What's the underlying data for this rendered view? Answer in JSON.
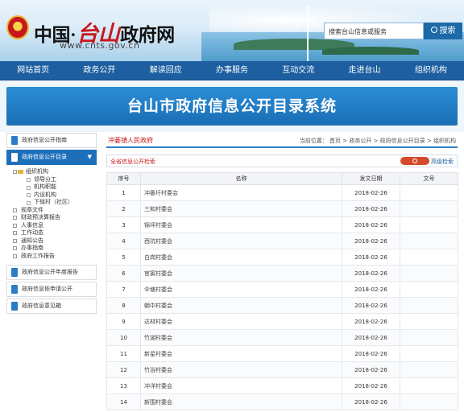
{
  "header": {
    "title_prefix": "中国·",
    "title_highlight": "台山",
    "title_suffix": "政府网",
    "url": "www.cnts.gov.cn",
    "search_placeholder": "搜索台山信息或服务",
    "search_button": "搜索"
  },
  "nav": [
    "网站首页",
    "政务公开",
    "解读回应",
    "办事服务",
    "互动交流",
    "走进台山",
    "组织机构"
  ],
  "banner_title": "台山市政府信息公开目录系统",
  "sidebar": {
    "guide": "政府信息公开指南",
    "catalog": "政府信息公开目录",
    "tree": {
      "root": "组织机构",
      "children": [
        "领导分工",
        "机构职能",
        "内设机构",
        "下辖村（社区）"
      ],
      "others": [
        "规章文件",
        "财政预决算报告",
        "人事信息",
        "工作动态",
        "通知公告",
        "办事指南",
        "政府工作报告"
      ]
    },
    "annual_report": "政府信息公开年度报告",
    "apply": "政府信息依申请公开",
    "feedback": "政府信息意见箱"
  },
  "main": {
    "org_name": "冲蒌镇人民政府",
    "breadcrumb": "当前位置： 首页 > 政务公开 > 政府信息公开目录 > 组织机构",
    "fulltext_label": "全省信息公开检索",
    "advanced": "高级检索",
    "table": {
      "headers": [
        "序号",
        "名称",
        "发文日期",
        "文号"
      ],
      "rows": [
        [
          "1",
          "冲蒌圩村委会",
          "2018-02-26",
          ""
        ],
        [
          "2",
          "三和村委会",
          "2018-02-26",
          ""
        ],
        [
          "3",
          "锦坪村委会",
          "2018-02-26",
          ""
        ],
        [
          "4",
          "西坑村委会",
          "2018-02-26",
          ""
        ],
        [
          "5",
          "白岗村委会",
          "2018-02-26",
          ""
        ],
        [
          "6",
          "官窦村委会",
          "2018-02-26",
          ""
        ],
        [
          "7",
          "伞塘村委会",
          "2018-02-26",
          ""
        ],
        [
          "8",
          "朝中村委会",
          "2018-02-26",
          ""
        ],
        [
          "9",
          "达材村委会",
          "2018-02-26",
          ""
        ],
        [
          "10",
          "竹湖村委会",
          "2018-02-26",
          ""
        ],
        [
          "11",
          "新星村委会",
          "2018-02-26",
          ""
        ],
        [
          "12",
          "竹浴村委会",
          "2018-02-26",
          ""
        ],
        [
          "13",
          "冲洋村委会",
          "2018-02-26",
          ""
        ],
        [
          "14",
          "新围村委会",
          "2018-02-26",
          ""
        ]
      ]
    }
  }
}
